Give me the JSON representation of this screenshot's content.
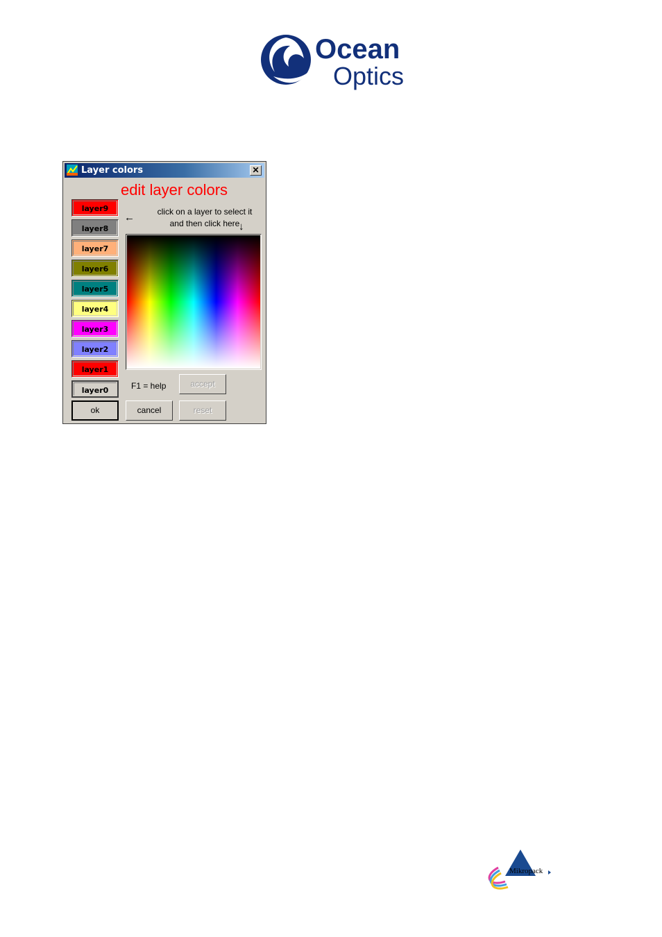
{
  "logo": {
    "line1": "Ocean",
    "line2": "Optics"
  },
  "window": {
    "title": "Layer colors",
    "close": "✕"
  },
  "dialog": {
    "heading": "edit layer colors",
    "hint_line1": "click on a layer to select it",
    "hint_line2": "and then click here",
    "arrow_left": "←",
    "arrow_down": "↓",
    "f1_help": "F1 = help"
  },
  "layers": [
    {
      "label": "layer9",
      "color": "#ff0000"
    },
    {
      "label": "layer8",
      "color": "#808080"
    },
    {
      "label": "layer7",
      "color": "#ffb07a"
    },
    {
      "label": "layer6",
      "color": "#808000"
    },
    {
      "label": "layer5",
      "color": "#008080"
    },
    {
      "label": "layer4",
      "color": "#ffff80"
    },
    {
      "label": "layer3",
      "color": "#ff00ff"
    },
    {
      "label": "layer2",
      "color": "#8080ff"
    },
    {
      "label": "layer1",
      "color": "#ff0000"
    },
    {
      "label": "layer0",
      "color": "#d4d0c8"
    }
  ],
  "buttons": {
    "ok": "ok",
    "cancel": "cancel",
    "accept": "accept",
    "reset": "reset"
  },
  "footer_logo": {
    "text": "Mikropack"
  }
}
